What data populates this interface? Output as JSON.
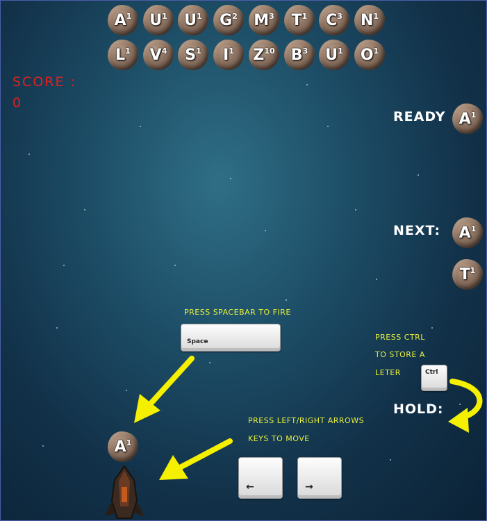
{
  "letter_row_1": [
    {
      "letter": "A",
      "points": "1"
    },
    {
      "letter": "U",
      "points": "1"
    },
    {
      "letter": "U",
      "points": "1"
    },
    {
      "letter": "G",
      "points": "2"
    },
    {
      "letter": "M",
      "points": "3"
    },
    {
      "letter": "T",
      "points": "1"
    },
    {
      "letter": "C",
      "points": "3"
    },
    {
      "letter": "N",
      "points": "1"
    }
  ],
  "letter_row_2": [
    {
      "letter": "L",
      "points": "1"
    },
    {
      "letter": "V",
      "points": "4"
    },
    {
      "letter": "S",
      "points": "1"
    },
    {
      "letter": "I",
      "points": "1"
    },
    {
      "letter": "Z",
      "points": "10"
    },
    {
      "letter": "B",
      "points": "3"
    },
    {
      "letter": "U",
      "points": "1"
    },
    {
      "letter": "O",
      "points": "1"
    }
  ],
  "score": {
    "label": "SCORE :",
    "value": "0"
  },
  "ready": {
    "label": "READY",
    "letter": "A",
    "points": "1"
  },
  "next": {
    "label": "NEXT:",
    "items": [
      {
        "letter": "A",
        "points": "1"
      },
      {
        "letter": "T",
        "points": "1"
      }
    ]
  },
  "hold": {
    "label": "HOLD:"
  },
  "ship_letter": {
    "letter": "A",
    "points": "1"
  },
  "instructions": {
    "fire": "PRESS SPACEBAR TO FIRE",
    "store_1": "PRESS CTRL",
    "store_2": "TO STORE A",
    "store_3": "LETER",
    "move_1": "PRESS LEFT/RIGHT ARROWS",
    "move_2": "KEYS TO MOVE"
  },
  "keys": {
    "space": "Space",
    "ctrl": "Ctrl",
    "left": "←",
    "right": "→"
  },
  "colors": {
    "arrow": "#f5f000",
    "score": "#e02020",
    "instruction": "#e8f03c"
  }
}
